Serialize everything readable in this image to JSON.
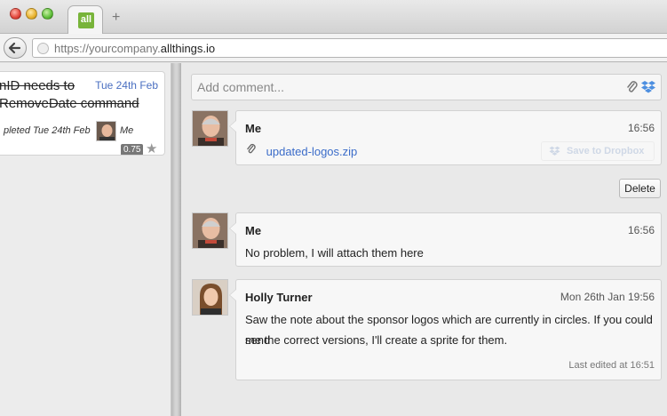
{
  "browser": {
    "tab_logo": "all",
    "new_tab": "+",
    "url_prefix": "https://yourcompany.",
    "url_domain": "allthings.io"
  },
  "task": {
    "title_line1": "nID needs to",
    "title_line2": "RemoveDate command",
    "date": "Tue 24th Feb",
    "completed": "pleted Tue 24th Feb",
    "assignee": "Me",
    "score": "0.75"
  },
  "composer": {
    "placeholder": "Add comment..."
  },
  "comments": [
    {
      "author": "Me",
      "time": "16:56",
      "file": "updated-logos.zip",
      "dropbox_label": "Save to Dropbox"
    },
    {
      "author": "Me",
      "time": "16:56",
      "text": "No problem, I will attach them here"
    },
    {
      "author": "Holly Turner",
      "time": "Mon 26th Jan 19:56",
      "text_line1": "Saw the note about the sponsor logos which are currently in circles. If you could send",
      "text_line2": "me the correct versions, I'll create a sprite for them.",
      "edited": "Last edited at 16:51"
    }
  ],
  "delete_label": "Delete",
  "colors": {
    "link": "#3b6cc9",
    "brand": "#78b43a",
    "dropbox": "#4d8fe0"
  }
}
